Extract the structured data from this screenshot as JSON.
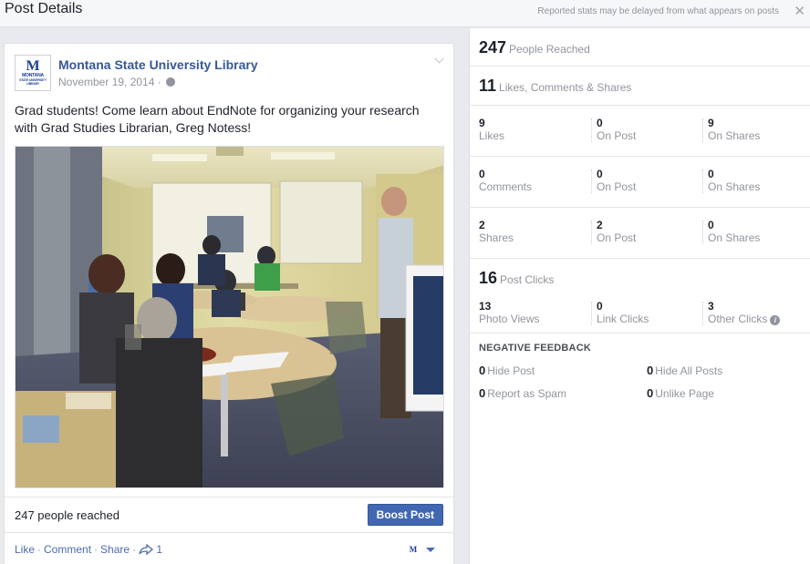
{
  "header": {
    "title": "Post Details",
    "notice": "Reported stats may be delayed from what appears on posts",
    "close_glyph": "✕"
  },
  "post": {
    "page_name": "Montana State University Library",
    "logo_text": [
      "MONTANA",
      "STATE UNIVERSITY",
      "LIBRARY"
    ],
    "date": "November 19, 2014",
    "date_sep": "·",
    "text": "Grad students! Come learn about EndNote for organizing your research with Grad Studies Librarian, Greg Notess!",
    "reached": "247 people reached",
    "boost_label": "Boost Post",
    "actions": {
      "like": "Like",
      "comment": "Comment",
      "share": "Share",
      "share_count": "1",
      "sep": "·"
    }
  },
  "stats": {
    "reach": {
      "value": "247",
      "label": "People Reached"
    },
    "engagement": {
      "value": "11",
      "label": "Likes, Comments & Shares"
    },
    "rows": [
      [
        {
          "n": "9",
          "l": "Likes"
        },
        {
          "n": "0",
          "l": "On Post"
        },
        {
          "n": "9",
          "l": "On Shares"
        }
      ],
      [
        {
          "n": "0",
          "l": "Comments"
        },
        {
          "n": "0",
          "l": "On Post"
        },
        {
          "n": "0",
          "l": "On Shares"
        }
      ],
      [
        {
          "n": "2",
          "l": "Shares"
        },
        {
          "n": "2",
          "l": "On Post"
        },
        {
          "n": "0",
          "l": "On Shares"
        }
      ]
    ],
    "clicks": {
      "value": "16",
      "label": "Post Clicks"
    },
    "click_row": [
      {
        "n": "13",
        "l": "Photo Views"
      },
      {
        "n": "0",
        "l": "Link Clicks"
      },
      {
        "n": "3",
        "l": "Other Clicks"
      }
    ],
    "negative": {
      "title": "NEGATIVE FEEDBACK",
      "items": [
        {
          "n": "0",
          "l": "Hide Post"
        },
        {
          "n": "0",
          "l": "Hide All Posts"
        },
        {
          "n": "0",
          "l": "Report as Spam"
        },
        {
          "n": "0",
          "l": "Unlike Page"
        }
      ]
    }
  },
  "colors": {
    "link": "#365899",
    "boost": "#4267b2",
    "muted": "#90949c"
  }
}
